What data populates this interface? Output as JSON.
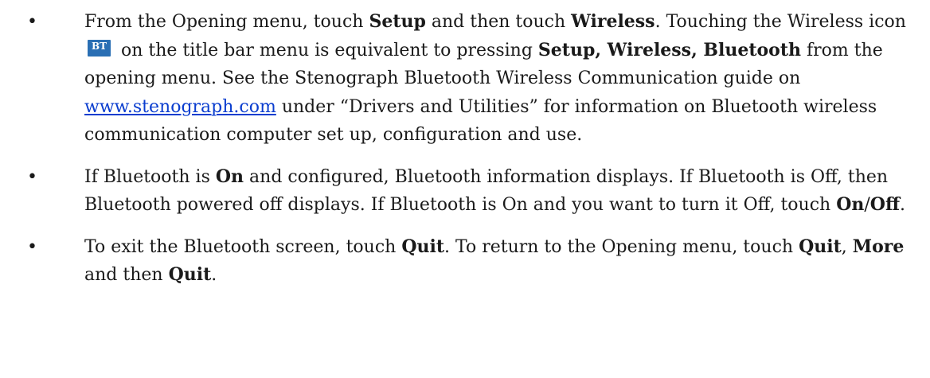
{
  "bullet_glyph": "•",
  "item1": {
    "t1": "From the Opening menu, touch ",
    "setup": "Setup",
    "t2": " and then touch ",
    "wireless": "Wireless",
    "t3": ". Touching the Wireless icon ",
    "icon_text": "BT",
    "t4": " on the title bar menu is equivalent to pressing ",
    "setup2": "Setup",
    "t5": ", ",
    "wireless2": "Wire­less, Bluetooth",
    "t6": " from the opening menu. See the Stenograph Bluetooth Wire­less Communication guide on ",
    "link": "www.stenograph.com",
    "t7": " under “Drivers and Utili­ties” for information on Bluetooth wireless communication computer set up, configuration and use."
  },
  "item2": {
    "t1": "If Bluetooth is ",
    "on": "On",
    "t2": " and configured, Bluetooth information displays. If Blue­tooth is Off, then Bluetooth powered off displays. If Bluetooth is On and you want to turn it Off, touch ",
    "on2": "On",
    "slash": "/",
    "off": "Off",
    "t3": "."
  },
  "item3": {
    "t1": "To exit the Bluetooth screen, touch ",
    "quit": "Quit",
    "t2": ". To return to the Opening menu, touch ",
    "quit2": "Quit",
    "t3": ", ",
    "more": "More",
    "t4": " and then ",
    "quit3": "Quit",
    "t5": "."
  },
  "colors": {
    "link": "#0a3dcf",
    "icon_bg": "#2a6fb4",
    "icon_fg": "#ffffff"
  },
  "icons": {
    "wireless": "bluetooth-icon"
  }
}
